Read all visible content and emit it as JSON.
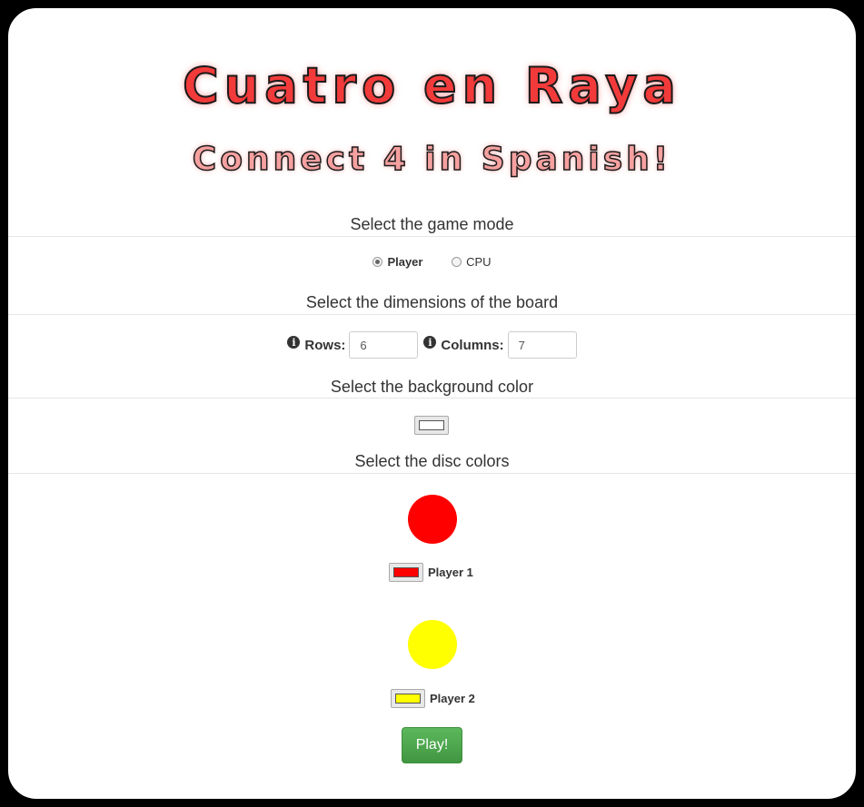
{
  "title": "Cuatro en Raya",
  "subtitle": "Connect 4 in Spanish!",
  "mode_section": {
    "heading": "Select the game mode",
    "options": [
      "Player",
      "CPU"
    ],
    "selected": "Player"
  },
  "board_section": {
    "heading": "Select the dimensions of the board",
    "rows_label": "Rows:",
    "rows_value": "6",
    "columns_label": "Columns:",
    "columns_value": "7"
  },
  "background_section": {
    "heading": "Select the background color",
    "color": "#ffffff"
  },
  "disc_section": {
    "heading": "Select the disc colors",
    "player1": {
      "label": "Player 1",
      "color": "#ff0000"
    },
    "player2": {
      "label": "Player 2",
      "color": "#ffff00"
    }
  },
  "play_button": "Play!",
  "icons": {
    "info": "info-circle-icon"
  },
  "colors": {
    "accent_green": "#449d44",
    "title_red": "#f23a3a"
  }
}
